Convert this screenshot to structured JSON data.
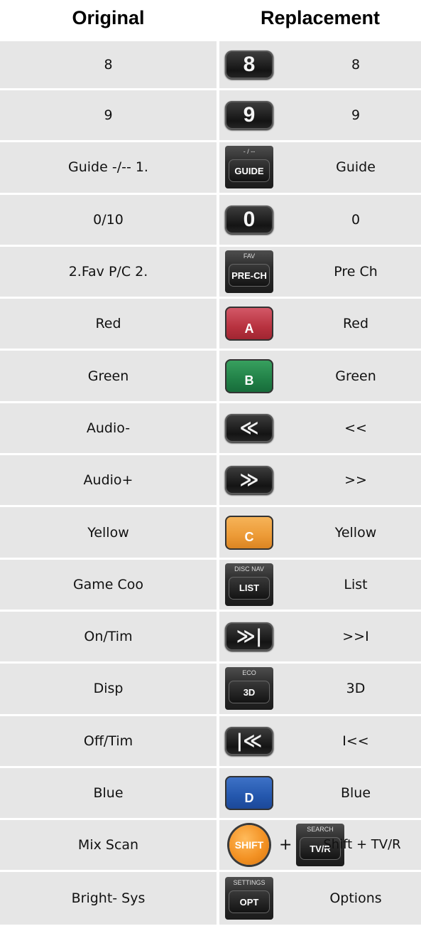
{
  "headers": {
    "original": "Original",
    "replacement": "Replacement"
  },
  "rows": [
    {
      "original": "8",
      "key_type": "num",
      "key": "8",
      "replacement": "8"
    },
    {
      "original": "9",
      "key_type": "num",
      "key": "9",
      "replacement": "9"
    },
    {
      "original": "Guide -/-- 1.",
      "key_type": "tile",
      "key_top": "- / --",
      "key": "GUIDE",
      "replacement": "Guide"
    },
    {
      "original": "0/10",
      "key_type": "num",
      "key": "0",
      "replacement": "0"
    },
    {
      "original": "2.Fav P/C 2.",
      "key_type": "tile",
      "key_top": "FAV",
      "key": "PRE-CH",
      "replacement": "Pre Ch"
    },
    {
      "original": "Red",
      "key_type": "color",
      "key_color": "red",
      "key": "A",
      "replacement": "Red"
    },
    {
      "original": "Green",
      "key_type": "color",
      "key_color": "green",
      "key": "B",
      "replacement": "Green"
    },
    {
      "original": "Audio-",
      "key_type": "arrow",
      "key": "≪",
      "key_icon": "rewind-icon",
      "replacement": "<<"
    },
    {
      "original": "Audio+",
      "key_type": "arrow",
      "key": "≫",
      "key_icon": "fast-forward-icon",
      "replacement": ">>"
    },
    {
      "original": "Yellow",
      "key_type": "color",
      "key_color": "yellow",
      "key": "C",
      "replacement": "Yellow"
    },
    {
      "original": "Game Coo",
      "key_type": "tile",
      "key_top": "DISC NAV",
      "key": "LIST",
      "replacement": "List"
    },
    {
      "original": "On/Tim",
      "key_type": "arrow",
      "key": "≫|",
      "key_icon": "skip-next-icon",
      "replacement": ">>I"
    },
    {
      "original": "Disp",
      "key_type": "tile",
      "key_top": "ECO",
      "key": "3D",
      "replacement": "3D"
    },
    {
      "original": "Off/Tim",
      "key_type": "arrow",
      "key": "|≪",
      "key_icon": "skip-previous-icon",
      "replacement": "I<<"
    },
    {
      "original": "Blue",
      "key_type": "color",
      "key_color": "blue",
      "key": "D",
      "replacement": "Blue"
    },
    {
      "original": "Mix Scan",
      "key_type": "combo",
      "key": "SHIFT",
      "combo_plus": "+",
      "key2_top": "SEARCH",
      "key2": "TV/R",
      "replacement": "Shift + TV/R"
    },
    {
      "original": "Bright- Sys",
      "key_type": "tile",
      "key_top": "SETTINGS",
      "key": "OPT",
      "replacement": "Options"
    }
  ],
  "colors": {
    "cell_bg": "#e6e6e6",
    "red": "#b8323f",
    "green": "#218047",
    "yellow": "#ec9a36",
    "blue": "#2457ad",
    "shift": "#f39224"
  }
}
